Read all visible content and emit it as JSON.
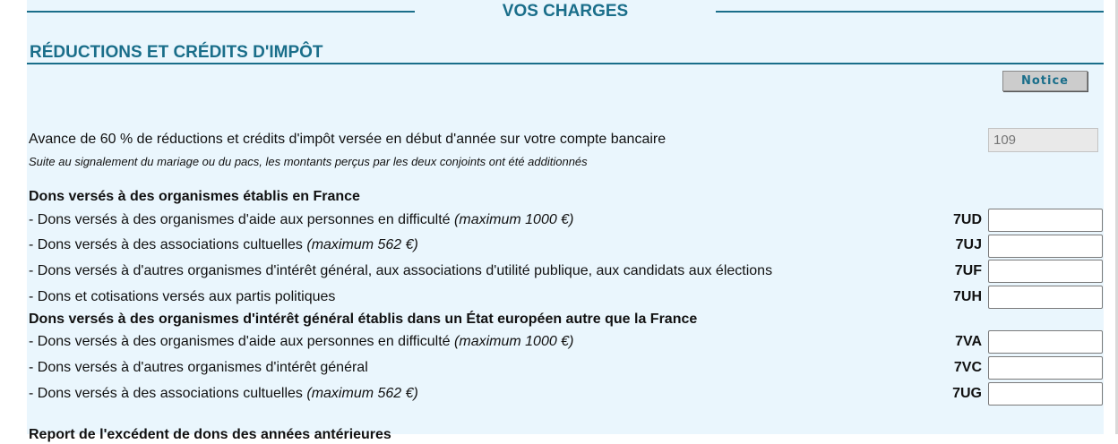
{
  "header": {
    "title": "VOS CHARGES"
  },
  "section": {
    "title": "RÉDUCTIONS ET CRÉDITS D'IMPÔT",
    "notice_label": "Notice"
  },
  "advance": {
    "label": "Avance de 60 % de réductions et crédits d'impôt versée en début d'année sur votre compte bancaire",
    "value": "109",
    "note": "Suite au signalement du mariage ou du pacs, les montants perçus par les deux conjoints ont été additionnés"
  },
  "france": {
    "heading": "Dons versés à des organismes établis en France",
    "rows": [
      {
        "label": " - Dons versés à des organismes d'aide aux personnes en difficulté ",
        "hint": "(maximum 1000 €)",
        "code": "7UD",
        "value": ""
      },
      {
        "label": " - Dons versés à des associations cultuelles ",
        "hint": "(maximum 562 €)",
        "code": "7UJ",
        "value": ""
      },
      {
        "label": " - Dons versés à d'autres organismes d'intérêt général, aux associations d'utilité publique, aux candidats aux élections",
        "hint": "",
        "code": "7UF",
        "value": ""
      },
      {
        "label": " - Dons et cotisations versés aux partis politiques",
        "hint": "",
        "code": "7UH",
        "value": ""
      }
    ]
  },
  "europe": {
    "heading": "Dons versés à des organismes d'intérêt général établis dans un État européen autre que la France",
    "rows": [
      {
        "label": " - Dons versés à des organismes d'aide aux personnes en difficulté ",
        "hint": "(maximum 1000 €)",
        "code": "7VA",
        "value": ""
      },
      {
        "label": " - Dons versés à d'autres organismes d'intérêt général",
        "hint": "",
        "code": "7VC",
        "value": ""
      },
      {
        "label": " - Dons versés à des associations cultuelles ",
        "hint": "(maximum 562 €)",
        "code": "7UG",
        "value": ""
      }
    ]
  },
  "report": {
    "heading": "Report de l'excédent de dons des années antérieures"
  }
}
